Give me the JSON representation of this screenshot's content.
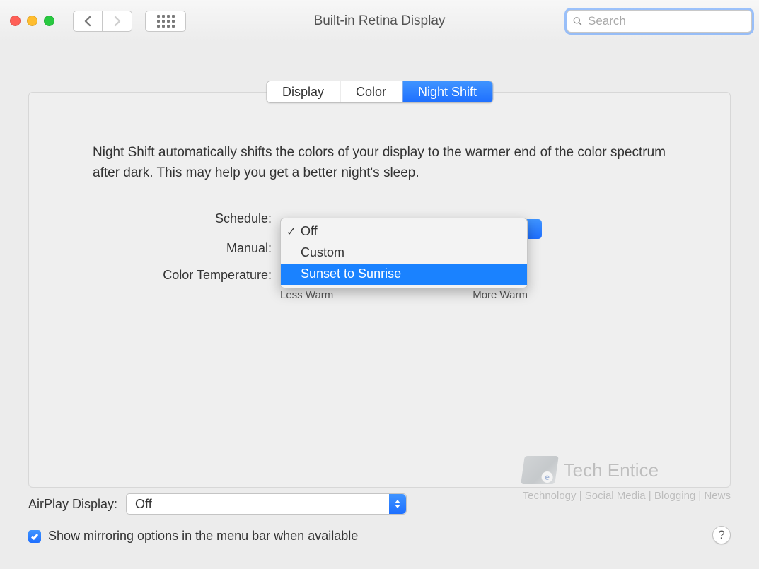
{
  "window": {
    "title": "Built-in Retina Display"
  },
  "search": {
    "placeholder": "Search",
    "value": ""
  },
  "tabs": {
    "display": "Display",
    "color": "Color",
    "night_shift": "Night Shift",
    "active_index": 2
  },
  "panel": {
    "description": "Night Shift automatically shifts the colors of your display to the warmer end of the color spectrum after dark. This may help you get a better night's sleep.",
    "schedule_label": "Schedule:",
    "manual_label": "Manual:",
    "color_temp_label": "Color Temperature:",
    "slider": {
      "less": "Less Warm",
      "more": "More Warm"
    }
  },
  "schedule_menu": {
    "options": [
      "Off",
      "Custom",
      "Sunset to Sunrise"
    ],
    "selected_index": 0,
    "highlighted_index": 2
  },
  "footer": {
    "airplay_label": "AirPlay Display:",
    "airplay_value": "Off",
    "mirroring_label": "Show mirroring options in the menu bar when available",
    "mirroring_checked": true,
    "help": "?"
  },
  "watermark": {
    "title": "Tech Entice",
    "tagline": "Technology | Social Media | Blogging | News"
  }
}
